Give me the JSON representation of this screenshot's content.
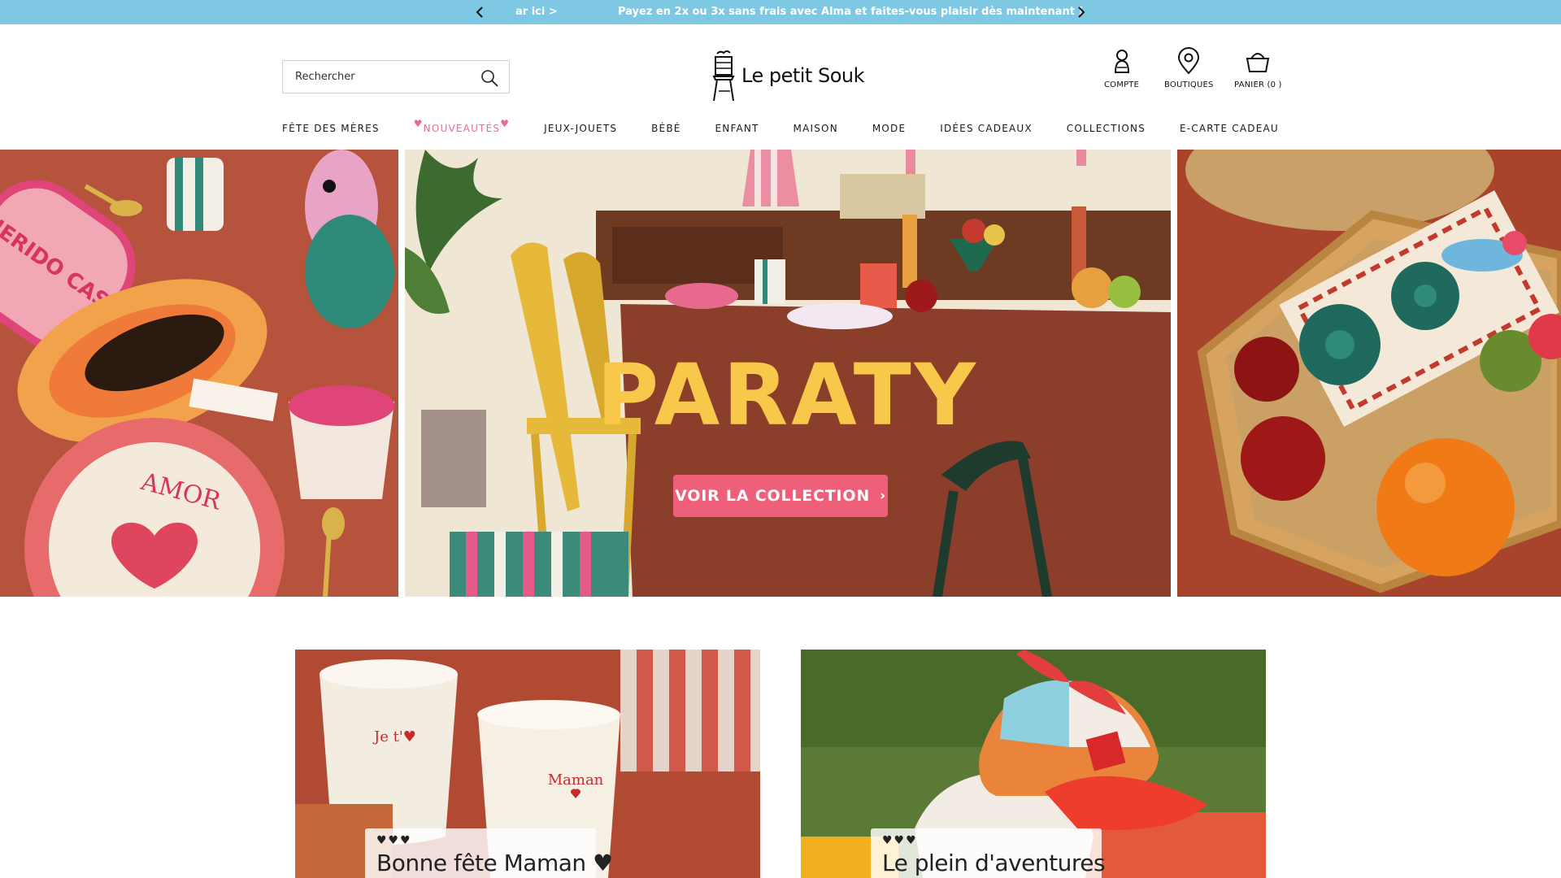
{
  "announcement": {
    "prev_label": "‹",
    "next_label": "›",
    "previous_message_fragment": "ar ici >",
    "message": "Payez en 2x ou 3x sans frais avec Alma et faites-vous plaisir dès maintenant !"
  },
  "header": {
    "search_placeholder": "Rechercher",
    "logo_text": "Le petit Souk",
    "account_label": "COMPTE",
    "stores_label": "BOUTIQUES",
    "cart_label": "PANIER (0 )"
  },
  "nav": {
    "items": [
      {
        "label": "FÊTE DES MÈRES"
      },
      {
        "label": "NOUVEAUTÉS",
        "decor": "♥"
      },
      {
        "label": "JEUX-JOUETS"
      },
      {
        "label": "BÉBÉ"
      },
      {
        "label": "ENFANT"
      },
      {
        "label": "MAISON"
      },
      {
        "label": "MODE"
      },
      {
        "label": "IDÉES CADEAUX"
      },
      {
        "label": "COLLECTIONS"
      },
      {
        "label": "E-CARTE CADEAU"
      }
    ]
  },
  "hero": {
    "title": "PARATY",
    "cta": "VOIR LA COLLECTION",
    "cta_icon": "chevron-right-icon",
    "left_plate_text": "AMOR",
    "left_tray_text": "QUERIDO CASA"
  },
  "cards": [
    {
      "hearts": "♥♥♥",
      "title": "Bonne fête Maman ♥",
      "cup_text_1": "Je t'♥",
      "cup_text_2": "Maman"
    },
    {
      "hearts": "♥♥♥",
      "title": "Le plein d'aventures"
    }
  ],
  "colors": {
    "announcement_bg": "#7ec8e3",
    "accent_pink": "#e96b8f",
    "cta_bg": "#ee5f7a",
    "hero_title": "#f7c84a"
  }
}
